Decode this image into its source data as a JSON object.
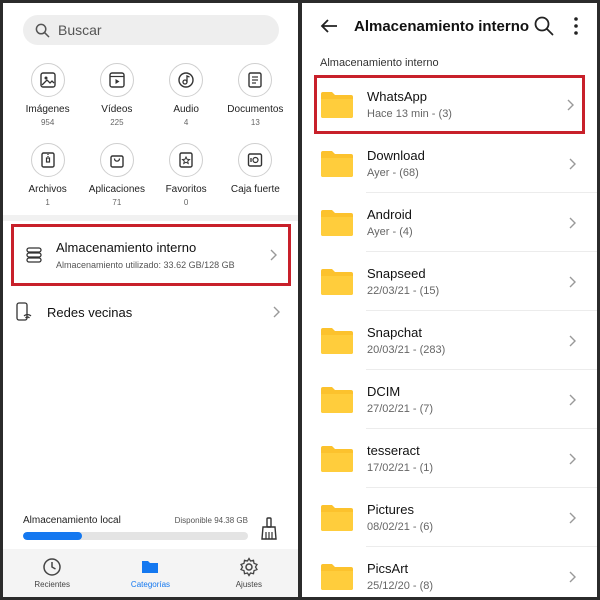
{
  "left": {
    "search": {
      "placeholder": "Buscar"
    },
    "categories": [
      {
        "label": "Imágenes",
        "count": "954",
        "icon": "image-icon"
      },
      {
        "label": "Vídeos",
        "count": "225",
        "icon": "video-icon"
      },
      {
        "label": "Audio",
        "count": "4",
        "icon": "music-icon"
      },
      {
        "label": "Documentos",
        "count": "13",
        "icon": "document-icon"
      },
      {
        "label": "Archivos",
        "count": "1",
        "icon": "archive-icon"
      },
      {
        "label": "Aplicaciones",
        "count": "71",
        "icon": "shopping-bag-icon"
      },
      {
        "label": "Favoritos",
        "count": "0",
        "icon": "star-icon"
      },
      {
        "label": "Caja fuerte",
        "count": "",
        "icon": "safe-icon"
      }
    ],
    "internal_storage": {
      "title": "Almacenamiento interno",
      "subtitle": "Almacenamiento utilizado: 33.62 GB/128 GB"
    },
    "nearby": {
      "title": "Redes vecinas"
    },
    "local_storage": {
      "label": "Almacenamiento local",
      "available": "Disponible 94.38 GB",
      "used_fraction": 0.263
    },
    "nav": [
      {
        "label": "Recientes",
        "icon": "clock-icon",
        "active": false
      },
      {
        "label": "Categorías",
        "icon": "folder-icon",
        "active": true
      },
      {
        "label": "Ajustes",
        "icon": "gear-icon",
        "active": false
      }
    ]
  },
  "right": {
    "title": "Almacenamiento interno",
    "breadcrumb": "Almacenamiento interno",
    "folders": [
      {
        "name": "WhatsApp",
        "meta": "Hace 13 min - (3)"
      },
      {
        "name": "Download",
        "meta": "Ayer - (68)"
      },
      {
        "name": "Android",
        "meta": "Ayer - (4)"
      },
      {
        "name": "Snapseed",
        "meta": "22/03/21 - (15)"
      },
      {
        "name": "Snapchat",
        "meta": "20/03/21 - (283)"
      },
      {
        "name": "DCIM",
        "meta": "27/02/21 - (7)"
      },
      {
        "name": "tesseract",
        "meta": "17/02/21 - (1)"
      },
      {
        "name": "Pictures",
        "meta": "08/02/21 - (6)"
      },
      {
        "name": "PicsArt",
        "meta": "25/12/20 - (8)"
      }
    ]
  },
  "colors": {
    "accent": "#1478f0",
    "highlight": "#c8202a",
    "folder": "#fcc22d"
  }
}
